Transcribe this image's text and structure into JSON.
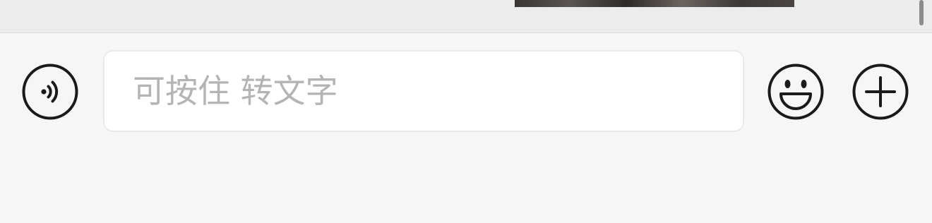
{
  "composer": {
    "placeholder": "可按住 转文字",
    "value": "",
    "icons": {
      "voice": "voice-input-icon",
      "emoji": "emoji-icon",
      "more": "plus-icon"
    }
  },
  "colors": {
    "icon_stroke": "#1a1a1a",
    "bar_background": "#f6f6f6",
    "input_background": "#ffffff",
    "placeholder": "#b4b4b4"
  }
}
